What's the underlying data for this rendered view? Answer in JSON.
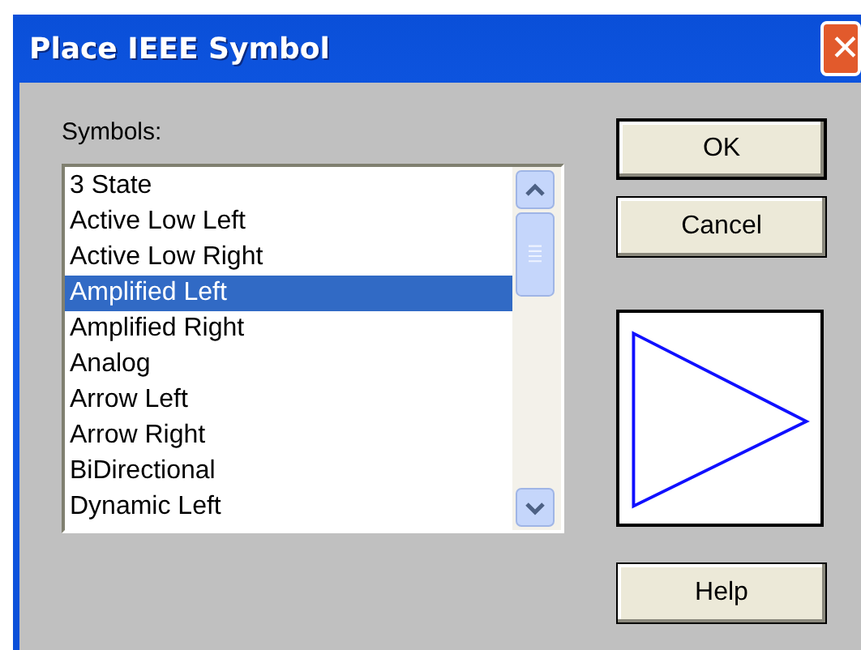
{
  "window": {
    "title": "Place IEEE Symbol",
    "close": "✕"
  },
  "symbols": {
    "label": "Symbols:",
    "items": [
      {
        "label": "3 State",
        "selected": false
      },
      {
        "label": "Active Low Left",
        "selected": false
      },
      {
        "label": "Active Low Right",
        "selected": false
      },
      {
        "label": "Amplified Left",
        "selected": true
      },
      {
        "label": "Amplified Right",
        "selected": false
      },
      {
        "label": "Analog",
        "selected": false
      },
      {
        "label": "Arrow Left",
        "selected": false
      },
      {
        "label": "Arrow Right",
        "selected": false
      },
      {
        "label": "BiDirectional",
        "selected": false
      },
      {
        "label": "Dynamic Left",
        "selected": false
      }
    ]
  },
  "buttons": [
    {
      "label": "OK",
      "kind": "default"
    },
    {
      "label": "Cancel",
      "kind": "normal"
    }
  ],
  "help_button": {
    "label": "Help"
  }
}
